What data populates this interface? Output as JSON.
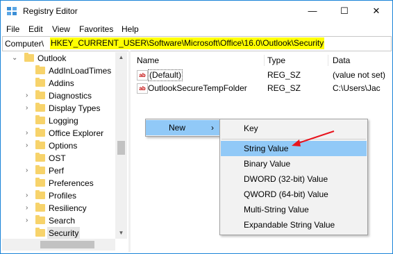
{
  "window": {
    "title": "Registry Editor",
    "accent": "#1883d7"
  },
  "caption_buttons": {
    "minimize": "—",
    "maximize": "☐",
    "close": "✕"
  },
  "menu": [
    "File",
    "Edit",
    "View",
    "Favorites",
    "Help"
  ],
  "address": {
    "prefix": "Computer\\",
    "path": "HKEY_CURRENT_USER\\Software\\Microsoft\\Office\\16.0\\Outlook\\Security",
    "highlight_color": "#ffff00"
  },
  "tree": {
    "parent": "Outlook",
    "items": [
      {
        "label": "AddInLoadTimes",
        "expandable": false
      },
      {
        "label": "Addins",
        "expandable": false
      },
      {
        "label": "Diagnostics",
        "expandable": true
      },
      {
        "label": "Display Types",
        "expandable": true
      },
      {
        "label": "Logging",
        "expandable": false
      },
      {
        "label": "Office Explorer",
        "expandable": true
      },
      {
        "label": "Options",
        "expandable": true
      },
      {
        "label": "OST",
        "expandable": false
      },
      {
        "label": "Perf",
        "expandable": true
      },
      {
        "label": "Preferences",
        "expandable": false
      },
      {
        "label": "Profiles",
        "expandable": true
      },
      {
        "label": "Resiliency",
        "expandable": true
      },
      {
        "label": "Search",
        "expandable": true
      },
      {
        "label": "Security",
        "expandable": false,
        "selected": true
      }
    ]
  },
  "list": {
    "columns": [
      "Name",
      "Type",
      "Data"
    ],
    "rows": [
      {
        "name": "(Default)",
        "type": "REG_SZ",
        "data": "(value not set)",
        "icon": "string-value-icon"
      },
      {
        "name": "OutlookSecureTempFolder",
        "type": "REG_SZ",
        "data": "C:\\Users\\Jac",
        "icon": "string-value-icon"
      }
    ]
  },
  "context_menu": {
    "new_label": "New",
    "submenu_arrow": "›",
    "items": [
      "Key",
      "String Value",
      "Binary Value",
      "DWORD (32-bit) Value",
      "QWORD (64-bit) Value",
      "Multi-String Value",
      "Expandable String Value"
    ],
    "highlighted": "String Value",
    "highlight_color": "#91c9f7",
    "pointer_arrow_color": "#e8141e"
  }
}
